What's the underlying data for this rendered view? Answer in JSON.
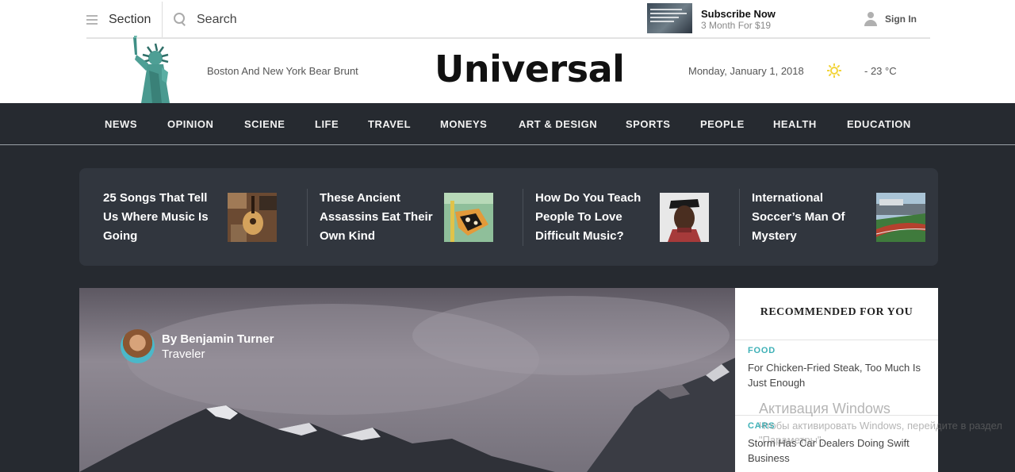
{
  "topbar": {
    "section_label": "Section",
    "search_placeholder": "Search",
    "subscribe_title": "Subscribe Now",
    "subscribe_sub": "3 Month For $19",
    "signin_label": "Sign In"
  },
  "header": {
    "tagline": "Boston And New York Bear Brunt",
    "logo": "Universal",
    "date": "Monday, January 1, 2018",
    "temperature": "- 23 °C",
    "weather_icon": "sun-icon"
  },
  "nav": {
    "items": [
      "NEWS",
      "OPINION",
      "SCIENE",
      "LIFE",
      "TRAVEL",
      "MONEYS",
      "ART & DESIGN",
      "SPORTS",
      "PEOPLE",
      "HEALTH",
      "EDUCATION"
    ]
  },
  "trending": [
    {
      "title": "25 Songs That Tell Us Where Music Is Going"
    },
    {
      "title": "These Ancient Assassins Eat Their Own Kind"
    },
    {
      "title": "How Do You Teach People To Love Difficult Music?"
    },
    {
      "title": "International Soccer’s Man Of Mystery"
    }
  ],
  "hero": {
    "author_name": "By Benjamin Turner",
    "author_role": "Traveler"
  },
  "recommended": {
    "title": "RECOMMENDED FOR YOU",
    "items": [
      {
        "category": "FOOD",
        "headline": "For Chicken-Fried Steak, Too Much Is Just Enough"
      },
      {
        "category": "CARS",
        "headline": "Storm Has Car Dealers Doing Swift Business"
      }
    ]
  },
  "watermark": {
    "line1": "Активация Windows",
    "line2": "Чтобы активировать Windows, перейдите в раздел \"Параметры\"."
  },
  "colors": {
    "nav_bg": "#262a30",
    "strip_bg": "#31363e",
    "accent_category": "#3fb1b7",
    "sun": "#f2d43a"
  }
}
